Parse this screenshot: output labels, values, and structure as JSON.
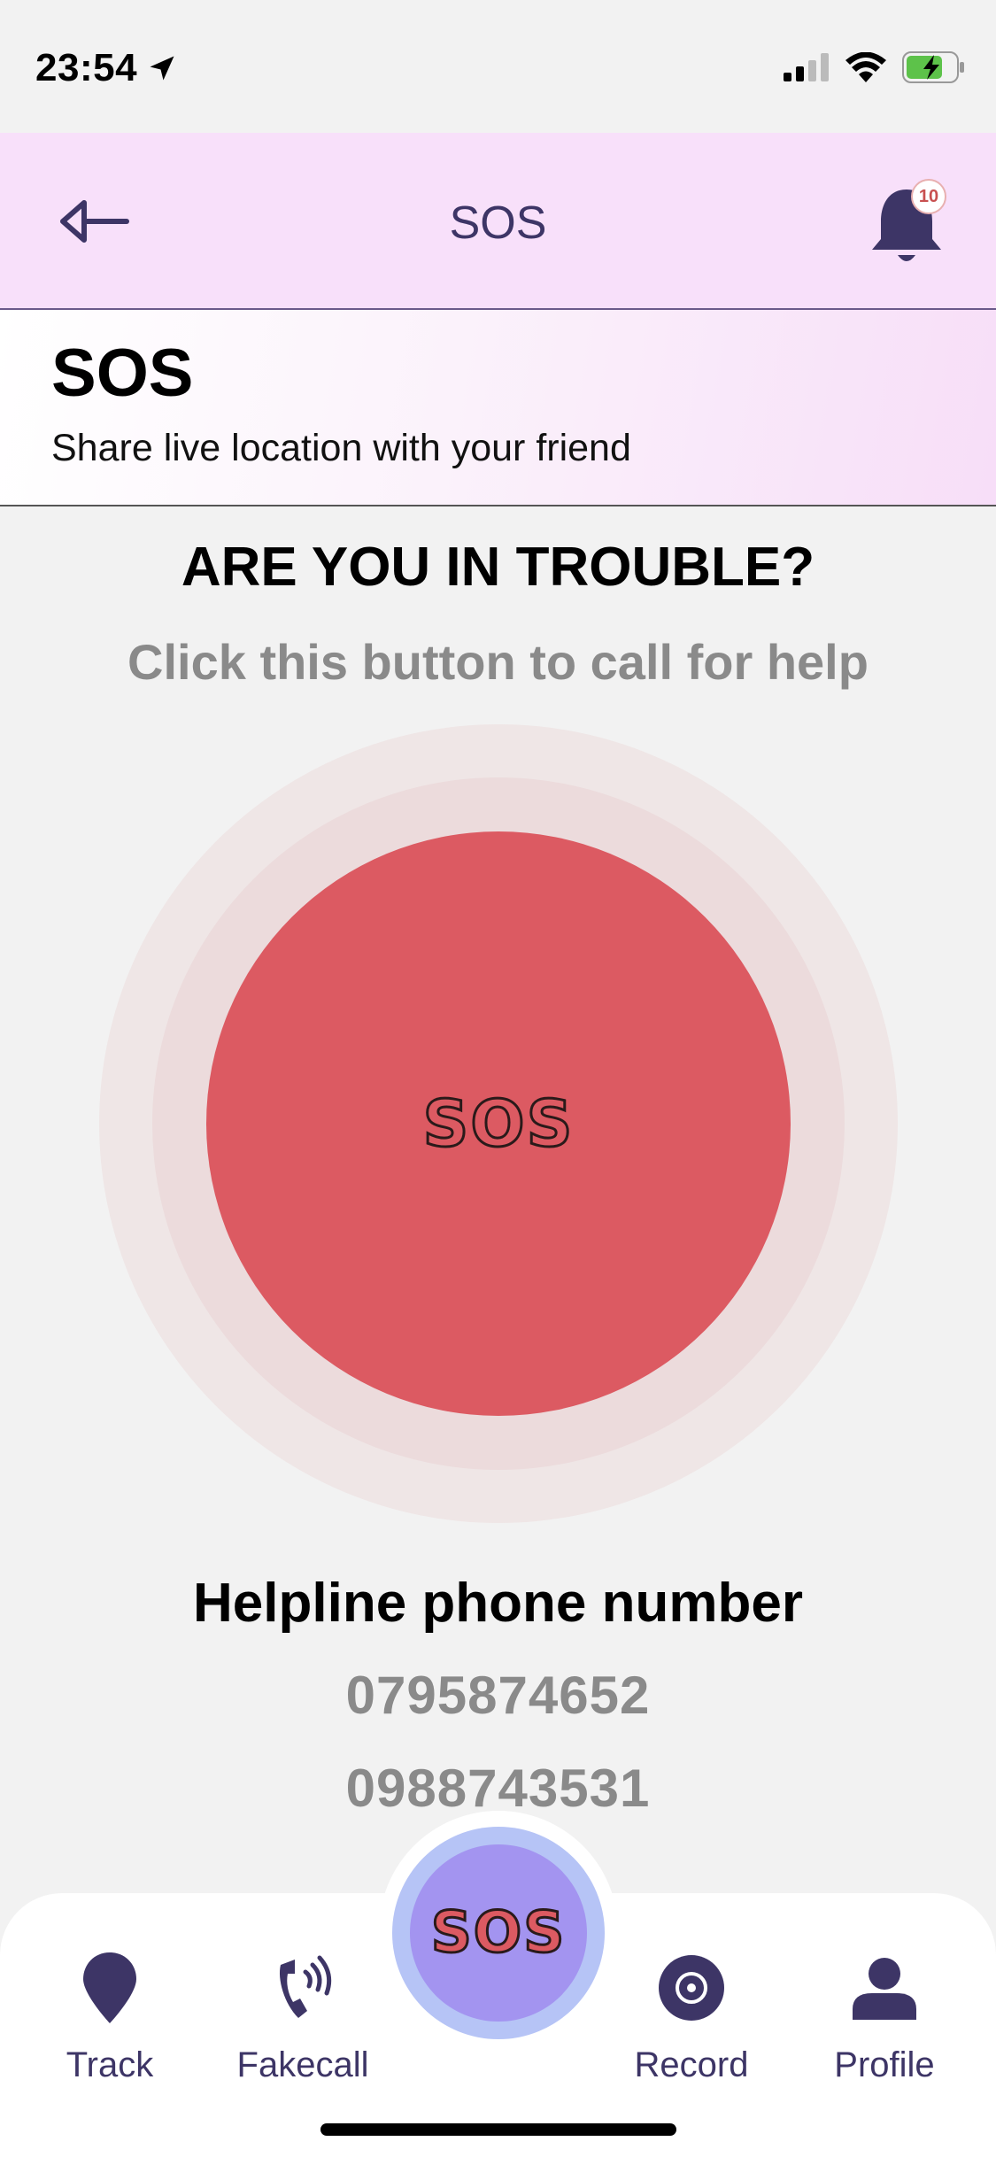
{
  "status_bar": {
    "time": "23:54",
    "icons": [
      "location-arrow-icon",
      "cellular-signal-icon",
      "wifi-icon",
      "battery-charging-icon"
    ]
  },
  "header": {
    "title": "SOS",
    "back_icon": "back-arrow-icon",
    "notification_icon": "bell-icon",
    "notification_count": "10"
  },
  "banner": {
    "title": "SOS",
    "subtitle": "Share live location with your friend"
  },
  "main": {
    "question": "ARE YOU IN TROUBLE?",
    "instruction": "Click this button to call for help",
    "sos_button_label": "SOS",
    "helpline_title": "Helpline phone number",
    "phones": [
      "0795874652",
      "0988743531"
    ]
  },
  "tabs": [
    {
      "label": "Track",
      "icon": "map-pin-icon"
    },
    {
      "label": "Fakecall",
      "icon": "phone-ringing-icon"
    },
    {
      "label": "SOS",
      "icon": "sos-icon"
    },
    {
      "label": "Record",
      "icon": "record-icon"
    },
    {
      "label": "Profile",
      "icon": "person-icon"
    }
  ],
  "colors": {
    "accent": "#3d3566",
    "sos_red": "#dc5a62",
    "header_bg": "#f8e0fa",
    "fab_purple": "#a394f0",
    "fab_ring": "#b6c4f6",
    "secondary_text": "#8a8a8a"
  }
}
